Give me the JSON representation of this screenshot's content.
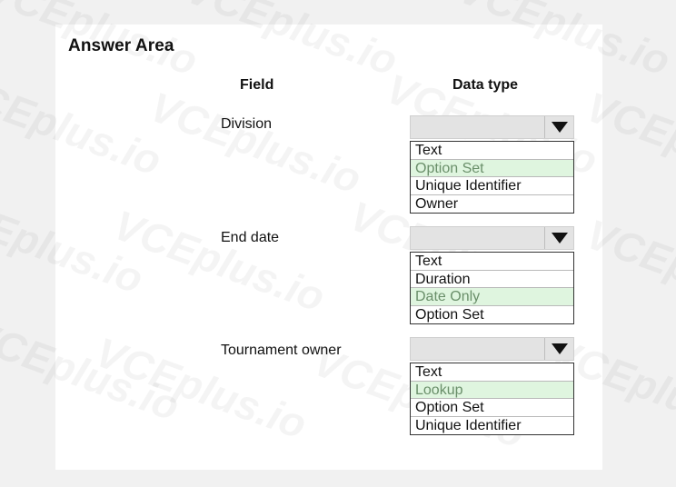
{
  "title": "Answer Area",
  "columns": {
    "field": "Field",
    "data_type": "Data type"
  },
  "watermark": "VCEplus.io",
  "rows": [
    {
      "field": "Division",
      "options": [
        "Text",
        "Option Set",
        "Unique Identifier",
        "Owner"
      ],
      "selected": "Option Set"
    },
    {
      "field": "End date",
      "options": [
        "Text",
        "Duration",
        "Date Only",
        "Option Set"
      ],
      "selected": "Date Only"
    },
    {
      "field": "Tournament owner",
      "options": [
        "Text",
        "Lookup",
        "Option Set",
        "Unique Identifier"
      ],
      "selected": "Lookup"
    }
  ],
  "colors": {
    "selected_bg": "#dff5df",
    "selected_text": "#6a8f6a"
  }
}
